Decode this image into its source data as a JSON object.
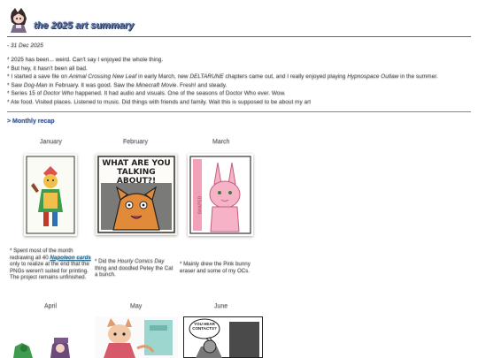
{
  "header": {
    "title": "the 2025 art summary",
    "avatar_icon": "character-avatar-icon"
  },
  "post": {
    "date": "- 31 Dec 2025",
    "bullets": [
      {
        "parts": [
          "2025 has been... weird. Can't say I enjoyed the whole thing."
        ]
      },
      {
        "parts": [
          "But hey, it hasn't been all bad."
        ]
      },
      {
        "parts": [
          "I started a save file on ",
          "Animal Crossing New Leaf",
          " in early March, new ",
          "DELTARUNE",
          " chapters came out, and I really enjoyed playing ",
          "Hypnospace Outlaw",
          " in the summer."
        ]
      },
      {
        "parts": [
          "Saw ",
          "Dog-Man",
          " in February. It was good. Saw the ",
          "Minecraft Movie",
          ". Fresh! and steady."
        ]
      },
      {
        "parts": [
          "Series 15 of ",
          "Doctor Who",
          " happened. It had audio and visuals. One of the seasons of Doctor Who ever. Wow."
        ]
      },
      {
        "parts": [
          "Ate food. Visited places. Listened to music. Did things with friends and family. Wait this is supposed to be about my art"
        ]
      }
    ]
  },
  "recap": {
    "heading": "> Monthly recap",
    "months": [
      {
        "name": "January",
        "caption_parts": [
          "Spent most of the month redrawing all 40 ",
          "Napoleon cards",
          " only to realize at the end that the PNGs weren't suited for printing. The project remains unfinished."
        ]
      },
      {
        "name": "February",
        "caption_parts": [
          "Did the ",
          "Hourly Comics Day",
          " thing and doodled Petey the Cat a bunch."
        ]
      },
      {
        "name": "March",
        "caption_parts": [
          "Mainly drew the Pink bunny eraser and some of my OCs."
        ]
      },
      {
        "name": "April",
        "caption_parts": [
          ""
        ]
      },
      {
        "name": "May",
        "caption_parts": [
          ""
        ]
      },
      {
        "name": "June",
        "caption_parts": [
          ""
        ]
      }
    ],
    "art_texts": {
      "february": "WHAT ARE YOU TALKING ABOUT?!",
      "march": "SHAPED",
      "june": "YOU HEAR CONTACTS?"
    }
  },
  "colors": {
    "title": "#5a73a6",
    "heading": "#3d5a99",
    "link": "#2d6f95"
  }
}
